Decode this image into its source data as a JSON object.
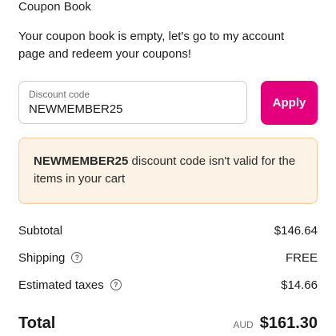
{
  "coupon_book": {
    "title": "Coupon Book",
    "message": "Your coupon book is empty, let's go to my account page and redeem your coupons!"
  },
  "discount": {
    "label": "Discount code",
    "value": "NEWMEMBER25",
    "apply_label": "Apply"
  },
  "alert": {
    "code": "NEWMEMBER25",
    "message": " discount code isn't valid for the items in your cart"
  },
  "summary": {
    "subtotal_label": "Subtotal",
    "subtotal_value": "$146.64",
    "shipping_label": "Shipping",
    "shipping_value": "FREE",
    "taxes_label": "Estimated taxes",
    "taxes_value": "$14.66",
    "help_icon": "?",
    "total_label": "Total",
    "currency": "AUD",
    "total_value": "$161.30"
  },
  "colors": {
    "accent": "#e4007c",
    "alert_bg": "#fdf2e6",
    "alert_border": "#f5cd9c"
  }
}
